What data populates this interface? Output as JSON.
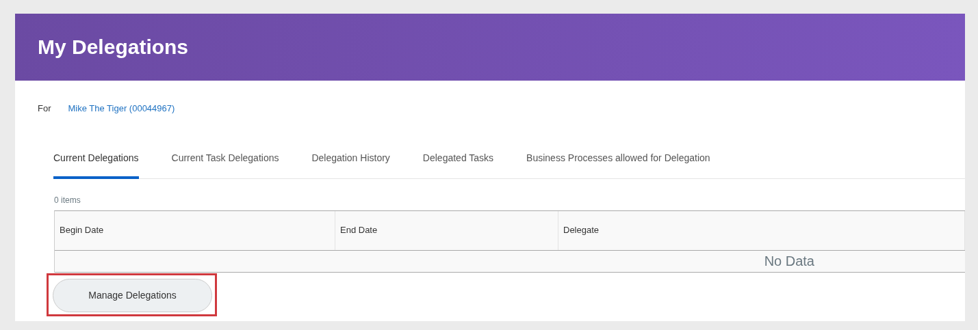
{
  "header": {
    "title": "My Delegations"
  },
  "for": {
    "label": "For",
    "worker": "Mike The Tiger (00044967)"
  },
  "tabs": [
    {
      "label": "Current Delegations",
      "selected": true
    },
    {
      "label": "Current Task Delegations",
      "selected": false
    },
    {
      "label": "Delegation History",
      "selected": false
    },
    {
      "label": "Delegated Tasks",
      "selected": false
    },
    {
      "label": "Business Processes allowed for Delegation",
      "selected": false
    }
  ],
  "table": {
    "count": "0 items",
    "columns": [
      "Begin Date",
      "End Date",
      "Delegate"
    ],
    "empty_message": "No Data"
  },
  "button": {
    "label": "Manage Delegations",
    "highlighted": true
  }
}
